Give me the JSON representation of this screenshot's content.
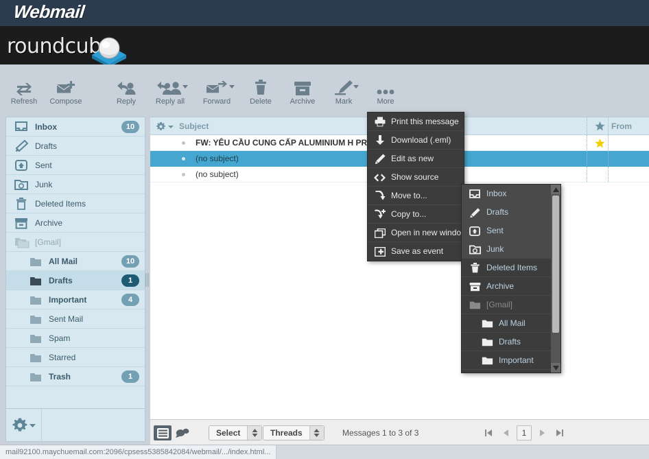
{
  "app": {
    "webmail_title": "Webmail",
    "brand": "roundcube"
  },
  "toolbar": {
    "items": [
      {
        "label": "Refresh",
        "icon": "refresh-icon"
      },
      {
        "label": "Compose",
        "icon": "compose-icon"
      },
      {
        "label": "Reply",
        "icon": "reply-icon"
      },
      {
        "label": "Reply all",
        "icon": "reply-all-icon"
      },
      {
        "label": "Forward",
        "icon": "forward-icon"
      },
      {
        "label": "Delete",
        "icon": "trash-icon"
      },
      {
        "label": "Archive",
        "icon": "archive-icon"
      },
      {
        "label": "Mark",
        "icon": "mark-icon"
      },
      {
        "label": "More",
        "icon": "more-dots-icon"
      }
    ]
  },
  "sidebar": {
    "folders": [
      {
        "label": "Inbox",
        "icon": "inbox-icon",
        "count": "10",
        "level": 0,
        "selected": false,
        "bold": true,
        "dim": false
      },
      {
        "label": "Drafts",
        "icon": "pencil-icon",
        "count": "",
        "level": 0,
        "selected": false,
        "bold": false,
        "dim": false
      },
      {
        "label": "Sent",
        "icon": "sent-icon",
        "count": "",
        "level": 0,
        "selected": false,
        "bold": false,
        "dim": false
      },
      {
        "label": "Junk",
        "icon": "junk-icon",
        "count": "",
        "level": 0,
        "selected": false,
        "bold": false,
        "dim": false
      },
      {
        "label": "Deleted Items",
        "icon": "trash-icon",
        "count": "",
        "level": 0,
        "selected": false,
        "bold": false,
        "dim": false
      },
      {
        "label": "Archive",
        "icon": "archive-icon",
        "count": "",
        "level": 0,
        "selected": false,
        "bold": false,
        "dim": false
      },
      {
        "label": "[Gmail]",
        "icon": "folder-icon",
        "count": "",
        "level": 0,
        "selected": false,
        "bold": false,
        "dim": true
      },
      {
        "label": "All Mail",
        "icon": "folder-icon",
        "count": "10",
        "level": 1,
        "selected": false,
        "bold": true,
        "dim": false
      },
      {
        "label": "Drafts",
        "icon": "folder-icon",
        "count": "1",
        "level": 1,
        "selected": true,
        "bold": true,
        "dim": false
      },
      {
        "label": "Important",
        "icon": "folder-icon",
        "count": "4",
        "level": 1,
        "selected": false,
        "bold": true,
        "dim": false
      },
      {
        "label": "Sent Mail",
        "icon": "folder-icon",
        "count": "",
        "level": 1,
        "selected": false,
        "bold": false,
        "dim": false
      },
      {
        "label": "Spam",
        "icon": "folder-icon",
        "count": "",
        "level": 1,
        "selected": false,
        "bold": false,
        "dim": false
      },
      {
        "label": "Starred",
        "icon": "folder-icon",
        "count": "",
        "level": 1,
        "selected": false,
        "bold": false,
        "dim": false
      },
      {
        "label": "Trash",
        "icon": "folder-icon",
        "count": "1",
        "level": 1,
        "selected": false,
        "bold": true,
        "dim": false
      }
    ],
    "settings_icon": "gear-icon"
  },
  "maillist": {
    "options_icon": "gear-icon",
    "columns": {
      "subject": "Subject",
      "flag": "star-icon",
      "from": "From"
    },
    "rows": [
      {
        "subject": "FW: YÊU CẦU CUNG CẤP ALUMINIUM H PROFILE ... d",
        "unread": true,
        "selected": false,
        "flagged": true,
        "from": ""
      },
      {
        "subject": "(no subject)",
        "unread": false,
        "selected": true,
        "flagged": false,
        "from": ""
      },
      {
        "subject": "(no subject)",
        "unread": false,
        "selected": false,
        "flagged": false,
        "from": ""
      }
    ]
  },
  "footer": {
    "list_mode_icon": "list-icon",
    "threads_mode_icon": "conversation-icon",
    "select_label": "Select",
    "threads_label": "Threads",
    "message_count": "Messages 1 to 3 of 3",
    "pager": {
      "first_icon": "first-page-icon",
      "prev_icon": "prev-page-icon",
      "page": "1",
      "next_icon": "next-page-icon",
      "last_icon": "last-page-icon"
    }
  },
  "statusbar": {
    "url": "mail92100.maychuemail.com:2096/cpsess5385842084/webmail/.../index.html..."
  },
  "context_menu": {
    "items": [
      {
        "label": "Print this message",
        "icon": "printer-icon"
      },
      {
        "label": "Download (.eml)",
        "icon": "download-icon"
      },
      {
        "label": "Edit as new",
        "icon": "pencil-icon"
      },
      {
        "label": "Show source",
        "icon": "code-icon"
      },
      {
        "label": "Move to...",
        "icon": "move-arrow-icon"
      },
      {
        "label": "Copy to...",
        "icon": "copy-arrow-icon"
      },
      {
        "label": "Open in new window",
        "icon": "window-icon"
      },
      {
        "label": "Save as event",
        "icon": "calendar-icon"
      }
    ]
  },
  "folder_submenu": {
    "items": [
      {
        "label": "Inbox",
        "icon": "inbox-icon",
        "level": 0,
        "dim": false,
        "highlight": true
      },
      {
        "label": "Drafts",
        "icon": "pencil-icon",
        "level": 0,
        "dim": false,
        "highlight": true
      },
      {
        "label": "Sent",
        "icon": "sent-icon",
        "level": 0,
        "dim": false,
        "highlight": true
      },
      {
        "label": "Junk",
        "icon": "junk-icon",
        "level": 0,
        "dim": false,
        "highlight": true
      },
      {
        "label": "Deleted Items",
        "icon": "trash-icon",
        "level": 0,
        "dim": false,
        "highlight": false
      },
      {
        "label": "Archive",
        "icon": "archive-icon",
        "level": 0,
        "dim": false,
        "highlight": false
      },
      {
        "label": "[Gmail]",
        "icon": "folder-icon",
        "level": 0,
        "dim": true,
        "highlight": false
      },
      {
        "label": "All Mail",
        "icon": "folder-icon",
        "level": 1,
        "dim": false,
        "highlight": false
      },
      {
        "label": "Drafts",
        "icon": "folder-icon",
        "level": 1,
        "dim": false,
        "highlight": false
      },
      {
        "label": "Important",
        "icon": "folder-icon",
        "level": 1,
        "dim": false,
        "highlight": false
      }
    ],
    "scroll_up_icon": "caret-up-icon",
    "scroll_down_icon": "caret-down-icon"
  },
  "colors": {
    "top_bar": "#2b3c4e",
    "brand_bar": "#1c1c1c",
    "toolbar_bg": "#c9d1da",
    "sidebar_bg": "#d7e8f0",
    "selected_row": "#45a7cf",
    "menu_bg": "#3c3c3c",
    "badge": "#74a0b4",
    "badge_active": "#1d5a73",
    "star": "#f2d000"
  }
}
